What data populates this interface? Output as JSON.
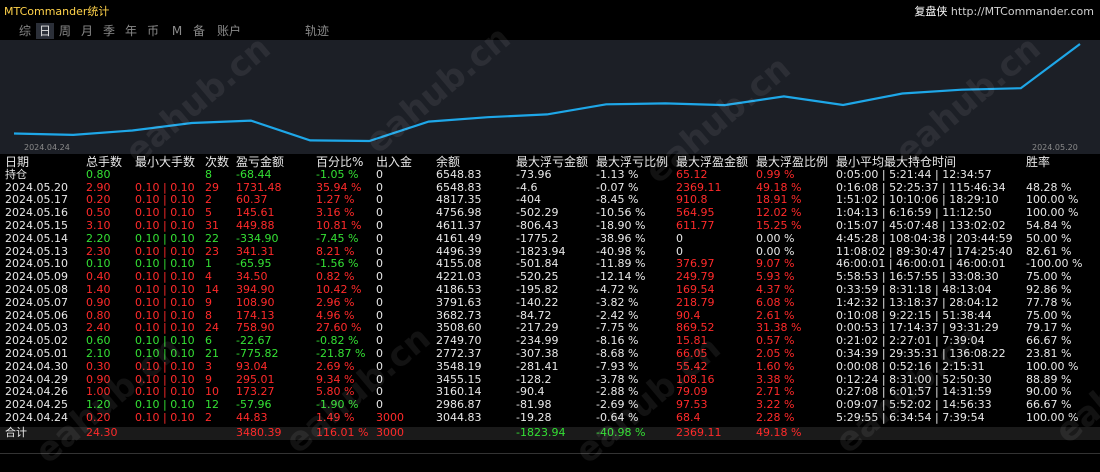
{
  "app": {
    "title": "MTCommander统计",
    "brand_cn": "复盘侠",
    "brand_url": "http://MTCommander.com"
  },
  "tabs": [
    {
      "label": "综"
    },
    {
      "label": "日"
    },
    {
      "label": "周"
    },
    {
      "label": "月"
    },
    {
      "label": "季"
    },
    {
      "label": "年"
    },
    {
      "label": "币"
    },
    {
      "label": "M"
    },
    {
      "label": "备"
    },
    {
      "label": "账户"
    },
    {
      "label": "轨迹"
    }
  ],
  "active_tab": "日",
  "watermark": "eahub.cn",
  "colors": {
    "positive": "#34e034",
    "negative": "#ff2a2a",
    "line": "#1ea7e8",
    "chart_bg": "#1c1f26"
  },
  "chart_data": {
    "type": "line",
    "x_start_label": "2024.04.24",
    "x_end_label": "2024.05.20",
    "x": [
      "2024.04.24",
      "2024.04.25",
      "2024.04.26",
      "2024.04.29",
      "2024.04.30",
      "2024.05.01",
      "2024.05.02",
      "2024.05.03",
      "2024.05.06",
      "2024.05.07",
      "2024.05.08",
      "2024.05.09",
      "2024.05.10",
      "2024.05.13",
      "2024.05.14",
      "2024.05.15",
      "2024.05.16",
      "2024.05.17",
      "2024.05.20"
    ],
    "values": [
      3044.83,
      2986.87,
      3160.14,
      3455.15,
      3548.19,
      2772.37,
      2749.7,
      3508.6,
      3682.73,
      3791.63,
      4186.53,
      4221.03,
      4155.08,
      4496.39,
      4161.49,
      4611.37,
      4756.98,
      4817.35,
      6548.83
    ],
    "series": [
      {
        "values": [
          3044.83,
          2986.87,
          3160.14,
          3455.15,
          3548.19,
          2772.37,
          2749.7,
          3508.6,
          3682.73,
          3791.63,
          4186.53,
          4221.03,
          4155.08,
          4496.39,
          4161.49,
          4611.37,
          4756.98,
          4817.35,
          6548.83
        ]
      }
    ],
    "grid": false
  },
  "table": {
    "headers": [
      "日期",
      "总手数",
      "最小大手数",
      "次数",
      "盈亏金额",
      "百分比%",
      "出入金",
      "余额",
      "最大浮亏金额",
      "最大浮亏比例",
      "最大浮盈金额",
      "最大浮盈比例",
      "最小平均最大持仓时间",
      "胜率"
    ],
    "rows": [
      {
        "date": "持仓",
        "lots": "0.80",
        "minmax": "",
        "count": "8",
        "pnl": "-68.44",
        "pct": "-1.05 %",
        "dep": "0",
        "bal": "6548.83",
        "mfl": "-73.96",
        "mflp": "-1.13 %",
        "mfp": "65.12",
        "mfpp": "0.99 %",
        "hold": "0:05:00 | 5:21:44 | 12:34:57",
        "win": "",
        "sign": "pos"
      },
      {
        "date": "2024.05.20",
        "lots": "2.90",
        "minmax": "0.10 | 0.10",
        "count": "29",
        "pnl": "1731.48",
        "pct": "35.94 %",
        "dep": "0",
        "bal": "6548.83",
        "mfl": "-4.6",
        "mflp": "-0.07 %",
        "mfp": "2369.11",
        "mfpp": "49.18 %",
        "hold": "0:16:08 | 52:25:37 | 115:46:34",
        "win": "48.28 %",
        "sign": "neg"
      },
      {
        "date": "2024.05.17",
        "lots": "0.20",
        "minmax": "0.10 | 0.10",
        "count": "2",
        "pnl": "60.37",
        "pct": "1.27 %",
        "dep": "0",
        "bal": "4817.35",
        "mfl": "-404",
        "mflp": "-8.45 %",
        "mfp": "910.8",
        "mfpp": "18.91 %",
        "hold": "1:51:02 | 10:10:06 | 18:29:10",
        "win": "100.00 %",
        "sign": "neg"
      },
      {
        "date": "2024.05.16",
        "lots": "0.50",
        "minmax": "0.10 | 0.10",
        "count": "5",
        "pnl": "145.61",
        "pct": "3.16 %",
        "dep": "0",
        "bal": "4756.98",
        "mfl": "-502.29",
        "mflp": "-10.56 %",
        "mfp": "564.95",
        "mfpp": "12.02 %",
        "hold": "1:04:13 | 6:16:59 | 11:12:50",
        "win": "100.00 %",
        "sign": "neg"
      },
      {
        "date": "2024.05.15",
        "lots": "3.10",
        "minmax": "0.10 | 0.10",
        "count": "31",
        "pnl": "449.88",
        "pct": "10.81 %",
        "dep": "0",
        "bal": "4611.37",
        "mfl": "-806.43",
        "mflp": "-18.90 %",
        "mfp": "611.77",
        "mfpp": "15.25 %",
        "hold": "0:15:07 | 45:07:48 | 133:02:02",
        "win": "54.84 %",
        "sign": "neg"
      },
      {
        "date": "2024.05.14",
        "lots": "2.20",
        "minmax": "0.10 | 0.10",
        "count": "22",
        "pnl": "-334.90",
        "pct": "-7.45 %",
        "dep": "0",
        "bal": "4161.49",
        "mfl": "-1775.2",
        "mflp": "-38.96 %",
        "mfp": "0",
        "mfpp": "0.00 %",
        "hold": "4:45:28 | 108:04:38 | 203:44:59",
        "win": "50.00 %",
        "sign": "pos"
      },
      {
        "date": "2024.05.13",
        "lots": "2.30",
        "minmax": "0.10 | 0.10",
        "count": "23",
        "pnl": "341.31",
        "pct": "8.21 %",
        "dep": "0",
        "bal": "4496.39",
        "mfl": "-1823.94",
        "mflp": "-40.98 %",
        "mfp": "0",
        "mfpp": "0.00 %",
        "hold": "11:08:02 | 89:30:47 | 174:25:40",
        "win": "82.61 %",
        "sign": "neg"
      },
      {
        "date": "2024.05.10",
        "lots": "0.10",
        "minmax": "0.10 | 0.10",
        "count": "1",
        "pnl": "-65.95",
        "pct": "-1.56 %",
        "dep": "0",
        "bal": "4155.08",
        "mfl": "-501.84",
        "mflp": "-11.89 %",
        "mfp": "376.97",
        "mfpp": "9.07 %",
        "hold": "46:00:01 | 46:00:01 | 46:00:01",
        "win": "-100.00 %",
        "sign": "pos"
      },
      {
        "date": "2024.05.09",
        "lots": "0.40",
        "minmax": "0.10 | 0.10",
        "count": "4",
        "pnl": "34.50",
        "pct": "0.82 %",
        "dep": "0",
        "bal": "4221.03",
        "mfl": "-520.25",
        "mflp": "-12.14 %",
        "mfp": "249.79",
        "mfpp": "5.93 %",
        "hold": "5:58:53 | 16:57:55 | 33:08:30",
        "win": "75.00 %",
        "sign": "neg"
      },
      {
        "date": "2024.05.08",
        "lots": "1.40",
        "minmax": "0.10 | 0.10",
        "count": "14",
        "pnl": "394.90",
        "pct": "10.42 %",
        "dep": "0",
        "bal": "4186.53",
        "mfl": "-195.82",
        "mflp": "-4.72 %",
        "mfp": "169.54",
        "mfpp": "4.37 %",
        "hold": "0:33:59 | 8:31:18 | 48:13:04",
        "win": "92.86 %",
        "sign": "neg"
      },
      {
        "date": "2024.05.07",
        "lots": "0.90",
        "minmax": "0.10 | 0.10",
        "count": "9",
        "pnl": "108.90",
        "pct": "2.96 %",
        "dep": "0",
        "bal": "3791.63",
        "mfl": "-140.22",
        "mflp": "-3.82 %",
        "mfp": "218.79",
        "mfpp": "6.08 %",
        "hold": "1:42:32 | 13:18:37 | 28:04:12",
        "win": "77.78 %",
        "sign": "neg"
      },
      {
        "date": "2024.05.06",
        "lots": "0.80",
        "minmax": "0.10 | 0.10",
        "count": "8",
        "pnl": "174.13",
        "pct": "4.96 %",
        "dep": "0",
        "bal": "3682.73",
        "mfl": "-84.72",
        "mflp": "-2.42 %",
        "mfp": "90.4",
        "mfpp": "2.61 %",
        "hold": "0:10:08 | 9:22:15 | 51:38:44",
        "win": "75.00 %",
        "sign": "neg"
      },
      {
        "date": "2024.05.03",
        "lots": "2.40",
        "minmax": "0.10 | 0.10",
        "count": "24",
        "pnl": "758.90",
        "pct": "27.60 %",
        "dep": "0",
        "bal": "3508.60",
        "mfl": "-217.29",
        "mflp": "-7.75 %",
        "mfp": "869.52",
        "mfpp": "31.38 %",
        "hold": "0:00:53 | 17:14:37 | 93:31:29",
        "win": "79.17 %",
        "sign": "neg"
      },
      {
        "date": "2024.05.02",
        "lots": "0.60",
        "minmax": "0.10 | 0.10",
        "count": "6",
        "pnl": "-22.67",
        "pct": "-0.82 %",
        "dep": "0",
        "bal": "2749.70",
        "mfl": "-234.99",
        "mflp": "-8.16 %",
        "mfp": "15.81",
        "mfpp": "0.57 %",
        "hold": "0:21:02 | 2:27:01 | 7:39:04",
        "win": "66.67 %",
        "sign": "pos"
      },
      {
        "date": "2024.05.01",
        "lots": "2.10",
        "minmax": "0.10 | 0.10",
        "count": "21",
        "pnl": "-775.82",
        "pct": "-21.87 %",
        "dep": "0",
        "bal": "2772.37",
        "mfl": "-307.38",
        "mflp": "-8.68 %",
        "mfp": "66.05",
        "mfpp": "2.05 %",
        "hold": "0:34:39 | 29:35:31 | 136:08:22",
        "win": "23.81 %",
        "sign": "pos"
      },
      {
        "date": "2024.04.30",
        "lots": "0.30",
        "minmax": "0.10 | 0.10",
        "count": "3",
        "pnl": "93.04",
        "pct": "2.69 %",
        "dep": "0",
        "bal": "3548.19",
        "mfl": "-281.41",
        "mflp": "-7.93 %",
        "mfp": "55.42",
        "mfpp": "1.60 %",
        "hold": "0:00:08 | 0:52:16 | 2:15:31",
        "win": "100.00 %",
        "sign": "neg"
      },
      {
        "date": "2024.04.29",
        "lots": "0.90",
        "minmax": "0.10 | 0.10",
        "count": "9",
        "pnl": "295.01",
        "pct": "9.34 %",
        "dep": "0",
        "bal": "3455.15",
        "mfl": "-128.2",
        "mflp": "-3.78 %",
        "mfp": "108.16",
        "mfpp": "3.38 %",
        "hold": "0:12:24 | 8:31:00 | 52:50:30",
        "win": "88.89 %",
        "sign": "neg"
      },
      {
        "date": "2024.04.26",
        "lots": "1.00",
        "minmax": "0.10 | 0.10",
        "count": "10",
        "pnl": "173.27",
        "pct": "5.80 %",
        "dep": "0",
        "bal": "3160.14",
        "mfl": "-90.4",
        "mflp": "-2.88 %",
        "mfp": "79.09",
        "mfpp": "2.71 %",
        "hold": "0:27:08 | 6:01:57 | 14:31:59",
        "win": "90.00 %",
        "sign": "neg"
      },
      {
        "date": "2024.04.25",
        "lots": "1.20",
        "minmax": "0.10 | 0.10",
        "count": "12",
        "pnl": "-57.96",
        "pct": "-1.90 %",
        "dep": "0",
        "bal": "2986.87",
        "mfl": "-81.98",
        "mflp": "-2.69 %",
        "mfp": "97.53",
        "mfpp": "3.22 %",
        "hold": "0:09:07 | 5:52:02 | 14:56:33",
        "win": "66.67 %",
        "sign": "pos"
      },
      {
        "date": "2024.04.24",
        "lots": "0.20",
        "minmax": "0.10 | 0.10",
        "count": "2",
        "pnl": "44.83",
        "pct": "1.49 %",
        "dep": "3000",
        "bal": "3044.83",
        "mfl": "-19.28",
        "mflp": "-0.64 %",
        "mfp": "68.4",
        "mfpp": "2.28 %",
        "hold": "5:29:55 | 6:34:54 | 7:39:54",
        "win": "100.00 %",
        "sign": "neg"
      }
    ],
    "total": {
      "date": "合计",
      "lots": "24.30",
      "minmax": "",
      "count": "",
      "pnl": "3480.39",
      "pct": "116.01 %",
      "dep": "3000",
      "bal": "",
      "mfl": "-1823.94",
      "mflp": "-40.98 %",
      "mfp": "2369.11",
      "mfpp": "49.18 %",
      "hold": "",
      "win": ""
    }
  }
}
